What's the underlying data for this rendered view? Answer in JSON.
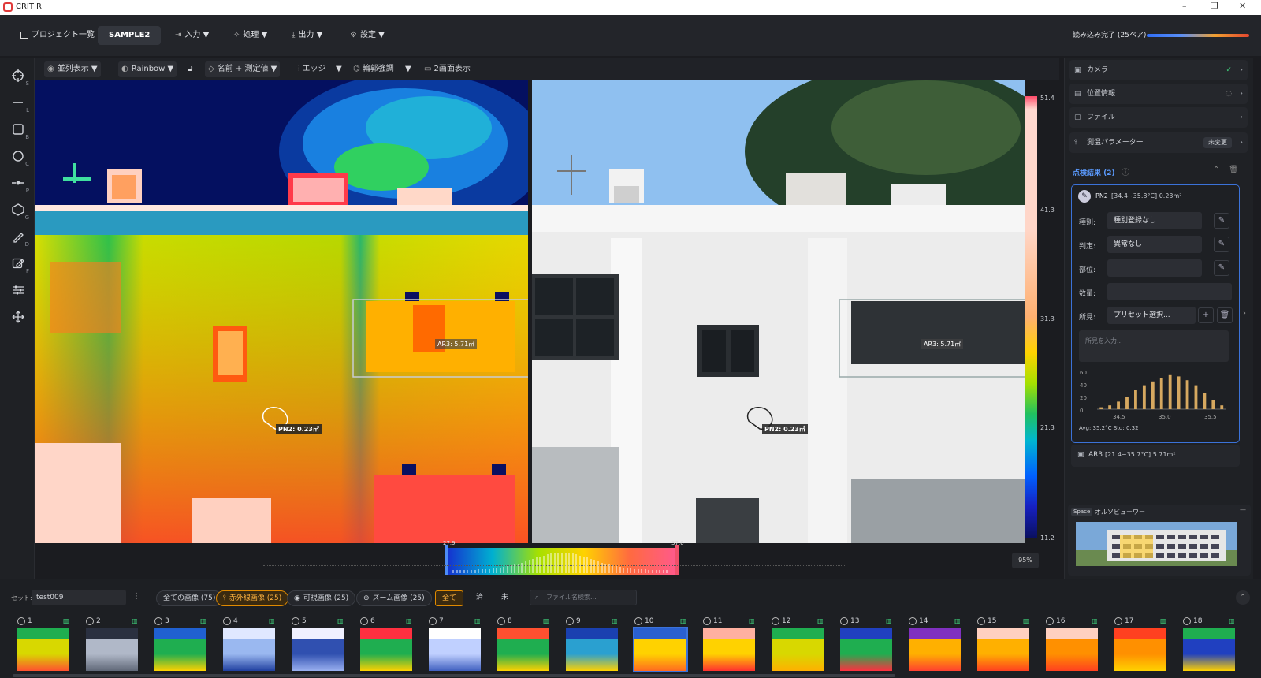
{
  "app": {
    "title": "CRITIR"
  },
  "window_controls": {
    "minimize": "–",
    "restore": "❐",
    "close": "✕"
  },
  "header": {
    "project_list": "プロジェクト一覧",
    "project_name": "SAMPLE2",
    "menus": [
      "入力 ▼",
      "処理 ▼",
      "出力 ▼",
      "設定 ▼"
    ],
    "status": "読み込み完了 (25ペア)"
  },
  "viewtoolbar": {
    "layout": "並列表示 ▼",
    "palette": "Rainbow ▼",
    "label_mode": "名前 + 測定値 ▼",
    "edge": "エッジ",
    "edge_arrow": "▼",
    "contour": "輪郭強調",
    "contour_arrow": "▼",
    "dual_view": "2画面表示"
  },
  "left_tools": [
    {
      "icon": "crosshair-icon",
      "key": "S"
    },
    {
      "icon": "line-icon",
      "key": "L"
    },
    {
      "icon": "rectangle-icon",
      "key": "B"
    },
    {
      "icon": "circle-icon",
      "key": "C"
    },
    {
      "icon": "point-icon",
      "key": "P"
    },
    {
      "icon": "polygon-icon",
      "key": "G"
    },
    {
      "icon": "pen-icon",
      "key": "D"
    },
    {
      "icon": "edit-icon",
      "key": "F"
    },
    {
      "icon": "sliders-icon",
      "key": ""
    },
    {
      "icon": "move-icon",
      "key": ""
    }
  ],
  "annotations": {
    "ar3": "AR3: 5.71㎡",
    "pn2": "PN2: 0.23㎡"
  },
  "scale": {
    "max": "51.4",
    "t1": "41.3",
    "t2": "31.3",
    "t3": "21.3",
    "min": "11.2"
  },
  "histogram": {
    "low": "27.9",
    "high": "37.6",
    "zoom": "95%"
  },
  "rightpanel": {
    "rows": [
      {
        "icon": "image-icon",
        "label": "カメラ",
        "status": "check"
      },
      {
        "icon": "map-icon",
        "label": "位置情報",
        "status": "pin"
      },
      {
        "icon": "file-icon",
        "label": "ファイル",
        "status": ""
      },
      {
        "icon": "thermometer-icon",
        "label": "測温パラメーター",
        "badge": "未変更"
      }
    ],
    "results_title": "点検結果 (2)",
    "card": {
      "title": "PN2",
      "detail": "[34.4~35.8°C] 0.23m²",
      "fields": [
        {
          "label": "種別:",
          "value": "種別登録なし"
        },
        {
          "label": "判定:",
          "value": "異常なし"
        },
        {
          "label": "部位:",
          "value": ""
        },
        {
          "label": "数量:",
          "value": ""
        },
        {
          "label": "所見:",
          "value": "プリセット選択..."
        }
      ],
      "note_placeholder": "所見を入力...",
      "hist_yticks": [
        "60",
        "40",
        "20",
        "0"
      ],
      "hist_xticks": [
        "34.5",
        "35.0",
        "35.5"
      ],
      "stats": "Avg: 35.2°C  Std: 0.32"
    },
    "card2": {
      "title": "AR3",
      "detail": "[21.4~35.7°C] 5.71m²"
    },
    "ortho": {
      "tag": "Space",
      "title": "オルソビューワー",
      "collapse": "—"
    }
  },
  "bottom": {
    "set_label": "セット:",
    "set_value": "test009",
    "filters": [
      "全ての画像 (75)",
      "赤外線画像 (25)",
      "可視画像 (25)",
      "ズーム画像 (25)"
    ],
    "status_filters": [
      "全て",
      "済",
      "未"
    ],
    "search_placeholder": "ファイル名検索...",
    "thumbs": [
      "1",
      "2",
      "3",
      "4",
      "5",
      "6",
      "7",
      "8",
      "9",
      "10",
      "11",
      "12",
      "13",
      "14",
      "15",
      "16",
      "17",
      "18"
    ]
  },
  "chart_data": {
    "type": "bar",
    "title": "",
    "categories": [
      "34.4",
      "34.5",
      "34.6",
      "34.7",
      "34.8",
      "34.9",
      "35.0",
      "35.1",
      "35.2",
      "35.3",
      "35.4",
      "35.5",
      "35.6",
      "35.7",
      "35.8"
    ],
    "values": [
      3,
      6,
      12,
      20,
      30,
      38,
      44,
      50,
      54,
      52,
      46,
      38,
      26,
      15,
      6
    ],
    "xlabel": "",
    "ylabel": "",
    "ylim": [
      0,
      60
    ],
    "bar_color": "#d6a860"
  }
}
